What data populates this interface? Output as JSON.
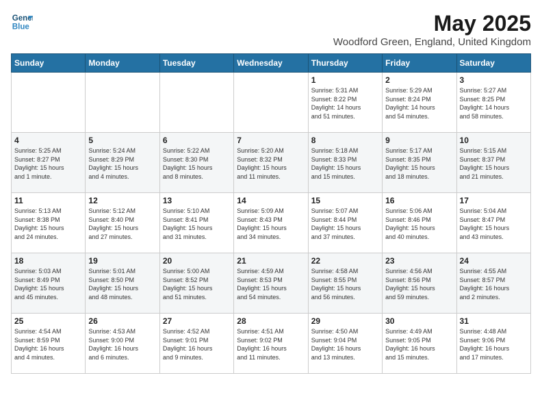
{
  "logo": {
    "line1": "General",
    "line2": "Blue"
  },
  "title": "May 2025",
  "subtitle": "Woodford Green, England, United Kingdom",
  "days_of_week": [
    "Sunday",
    "Monday",
    "Tuesday",
    "Wednesday",
    "Thursday",
    "Friday",
    "Saturday"
  ],
  "weeks": [
    [
      {
        "day": "",
        "detail": ""
      },
      {
        "day": "",
        "detail": ""
      },
      {
        "day": "",
        "detail": ""
      },
      {
        "day": "",
        "detail": ""
      },
      {
        "day": "1",
        "detail": "Sunrise: 5:31 AM\nSunset: 8:22 PM\nDaylight: 14 hours\nand 51 minutes."
      },
      {
        "day": "2",
        "detail": "Sunrise: 5:29 AM\nSunset: 8:24 PM\nDaylight: 14 hours\nand 54 minutes."
      },
      {
        "day": "3",
        "detail": "Sunrise: 5:27 AM\nSunset: 8:25 PM\nDaylight: 14 hours\nand 58 minutes."
      }
    ],
    [
      {
        "day": "4",
        "detail": "Sunrise: 5:25 AM\nSunset: 8:27 PM\nDaylight: 15 hours\nand 1 minute."
      },
      {
        "day": "5",
        "detail": "Sunrise: 5:24 AM\nSunset: 8:29 PM\nDaylight: 15 hours\nand 4 minutes."
      },
      {
        "day": "6",
        "detail": "Sunrise: 5:22 AM\nSunset: 8:30 PM\nDaylight: 15 hours\nand 8 minutes."
      },
      {
        "day": "7",
        "detail": "Sunrise: 5:20 AM\nSunset: 8:32 PM\nDaylight: 15 hours\nand 11 minutes."
      },
      {
        "day": "8",
        "detail": "Sunrise: 5:18 AM\nSunset: 8:33 PM\nDaylight: 15 hours\nand 15 minutes."
      },
      {
        "day": "9",
        "detail": "Sunrise: 5:17 AM\nSunset: 8:35 PM\nDaylight: 15 hours\nand 18 minutes."
      },
      {
        "day": "10",
        "detail": "Sunrise: 5:15 AM\nSunset: 8:37 PM\nDaylight: 15 hours\nand 21 minutes."
      }
    ],
    [
      {
        "day": "11",
        "detail": "Sunrise: 5:13 AM\nSunset: 8:38 PM\nDaylight: 15 hours\nand 24 minutes."
      },
      {
        "day": "12",
        "detail": "Sunrise: 5:12 AM\nSunset: 8:40 PM\nDaylight: 15 hours\nand 27 minutes."
      },
      {
        "day": "13",
        "detail": "Sunrise: 5:10 AM\nSunset: 8:41 PM\nDaylight: 15 hours\nand 31 minutes."
      },
      {
        "day": "14",
        "detail": "Sunrise: 5:09 AM\nSunset: 8:43 PM\nDaylight: 15 hours\nand 34 minutes."
      },
      {
        "day": "15",
        "detail": "Sunrise: 5:07 AM\nSunset: 8:44 PM\nDaylight: 15 hours\nand 37 minutes."
      },
      {
        "day": "16",
        "detail": "Sunrise: 5:06 AM\nSunset: 8:46 PM\nDaylight: 15 hours\nand 40 minutes."
      },
      {
        "day": "17",
        "detail": "Sunrise: 5:04 AM\nSunset: 8:47 PM\nDaylight: 15 hours\nand 43 minutes."
      }
    ],
    [
      {
        "day": "18",
        "detail": "Sunrise: 5:03 AM\nSunset: 8:49 PM\nDaylight: 15 hours\nand 45 minutes."
      },
      {
        "day": "19",
        "detail": "Sunrise: 5:01 AM\nSunset: 8:50 PM\nDaylight: 15 hours\nand 48 minutes."
      },
      {
        "day": "20",
        "detail": "Sunrise: 5:00 AM\nSunset: 8:52 PM\nDaylight: 15 hours\nand 51 minutes."
      },
      {
        "day": "21",
        "detail": "Sunrise: 4:59 AM\nSunset: 8:53 PM\nDaylight: 15 hours\nand 54 minutes."
      },
      {
        "day": "22",
        "detail": "Sunrise: 4:58 AM\nSunset: 8:55 PM\nDaylight: 15 hours\nand 56 minutes."
      },
      {
        "day": "23",
        "detail": "Sunrise: 4:56 AM\nSunset: 8:56 PM\nDaylight: 15 hours\nand 59 minutes."
      },
      {
        "day": "24",
        "detail": "Sunrise: 4:55 AM\nSunset: 8:57 PM\nDaylight: 16 hours\nand 2 minutes."
      }
    ],
    [
      {
        "day": "25",
        "detail": "Sunrise: 4:54 AM\nSunset: 8:59 PM\nDaylight: 16 hours\nand 4 minutes."
      },
      {
        "day": "26",
        "detail": "Sunrise: 4:53 AM\nSunset: 9:00 PM\nDaylight: 16 hours\nand 6 minutes."
      },
      {
        "day": "27",
        "detail": "Sunrise: 4:52 AM\nSunset: 9:01 PM\nDaylight: 16 hours\nand 9 minutes."
      },
      {
        "day": "28",
        "detail": "Sunrise: 4:51 AM\nSunset: 9:02 PM\nDaylight: 16 hours\nand 11 minutes."
      },
      {
        "day": "29",
        "detail": "Sunrise: 4:50 AM\nSunset: 9:04 PM\nDaylight: 16 hours\nand 13 minutes."
      },
      {
        "day": "30",
        "detail": "Sunrise: 4:49 AM\nSunset: 9:05 PM\nDaylight: 16 hours\nand 15 minutes."
      },
      {
        "day": "31",
        "detail": "Sunrise: 4:48 AM\nSunset: 9:06 PM\nDaylight: 16 hours\nand 17 minutes."
      }
    ]
  ]
}
